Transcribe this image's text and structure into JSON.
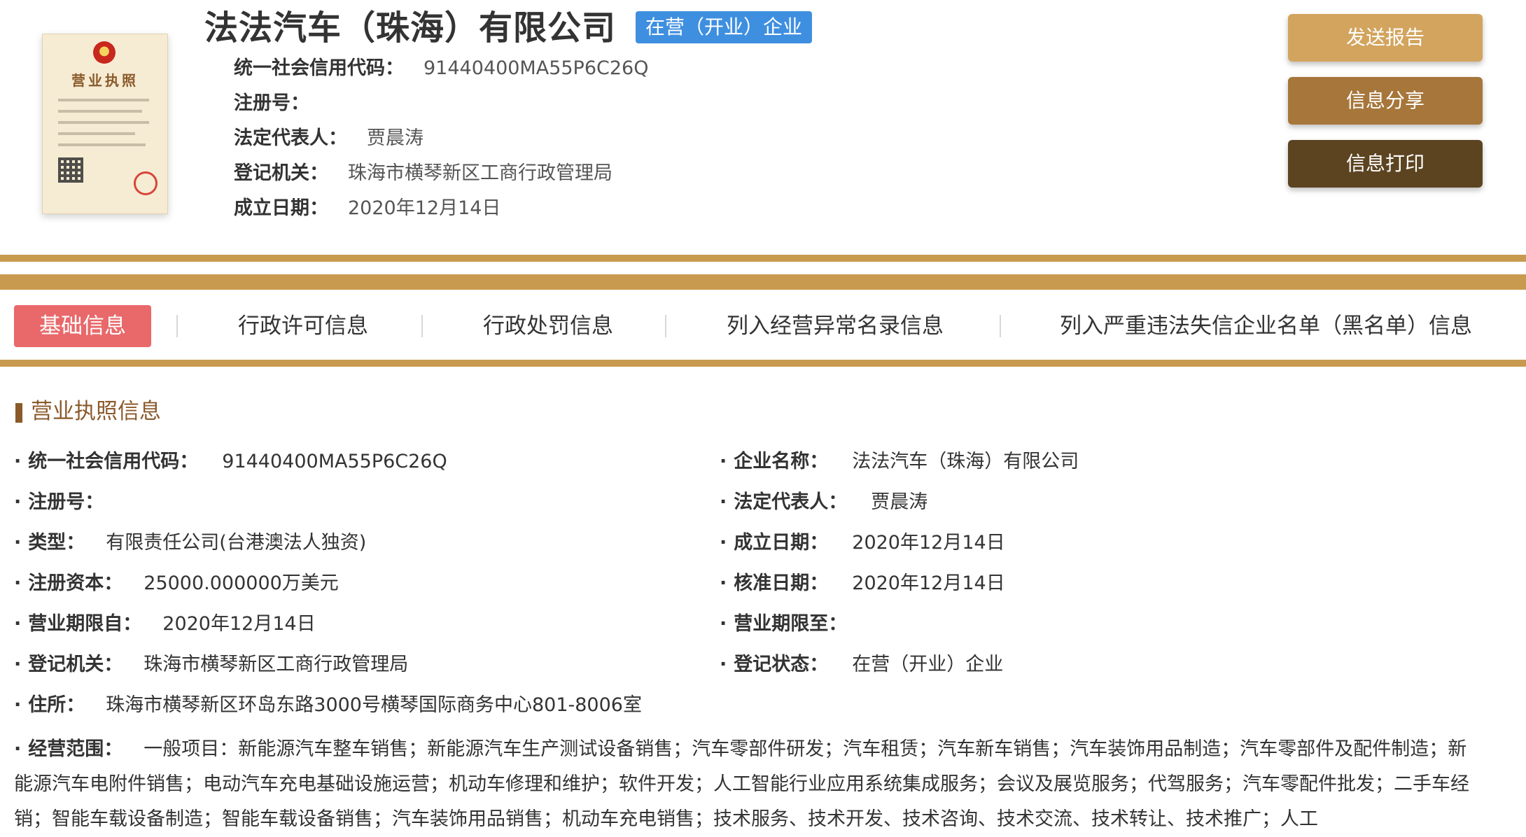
{
  "header": {
    "license_thumbnail": {
      "title": "营业执照"
    },
    "company_name": "法法汽车（珠海）有限公司",
    "status_badge": "在营（开业）企业",
    "info": [
      {
        "label": "统一社会信用代码：",
        "value": "91440400MA55P6C26Q"
      },
      {
        "label": "注册号：",
        "value": ""
      },
      {
        "label": "法定代表人：",
        "value": "贾晨涛"
      },
      {
        "label": "登记机关：",
        "value": "珠海市横琴新区工商行政管理局"
      },
      {
        "label": "成立日期：",
        "value": "2020年12月14日"
      }
    ],
    "buttons": {
      "send_report": "发送报告",
      "share_info": "信息分享",
      "print_info": "信息打印"
    }
  },
  "tabs": [
    {
      "label": "基础信息",
      "active": true
    },
    {
      "label": "行政许可信息",
      "active": false
    },
    {
      "label": "行政处罚信息",
      "active": false
    },
    {
      "label": "列入经营异常名录信息",
      "active": false
    },
    {
      "label": "列入严重违法失信企业名单（黑名单）信息",
      "active": false
    }
  ],
  "section": {
    "title": "营业执照信息",
    "left_fields": [
      {
        "label": "统一社会信用代码：",
        "value": "91440400MA55P6C26Q"
      },
      {
        "label": "注册号：",
        "value": ""
      },
      {
        "label": "类型：",
        "value": "有限责任公司(台港澳法人独资)"
      },
      {
        "label": "注册资本：",
        "value": "25000.000000万美元"
      },
      {
        "label": "营业期限自：",
        "value": "2020年12月14日"
      },
      {
        "label": "登记机关：",
        "value": "珠海市横琴新区工商行政管理局"
      },
      {
        "label": "住所：",
        "value": "珠海市横琴新区环岛东路3000号横琴国际商务中心801-8006室"
      }
    ],
    "right_fields": [
      {
        "label": "企业名称：",
        "value": "法法汽车（珠海）有限公司"
      },
      {
        "label": "法定代表人：",
        "value": "贾晨涛"
      },
      {
        "label": "成立日期：",
        "value": "2020年12月14日"
      },
      {
        "label": "核准日期：",
        "value": "2020年12月14日"
      },
      {
        "label": "营业期限至：",
        "value": ""
      },
      {
        "label": "登记状态：",
        "value": "在营（开业）企业"
      }
    ],
    "scope": {
      "label": "经营范围：",
      "value": "一般项目：新能源汽车整车销售；新能源汽车生产测试设备销售；汽车零部件研发；汽车租赁；汽车新车销售；汽车装饰用品制造；汽车零部件及配件制造；新能源汽车电附件销售；电动汽车充电基础设施运营；机动车修理和维护；软件开发；人工智能行业应用系统集成服务；会议及展览服务；代驾服务；汽车零配件批发；二手车经销；智能车载设备制造；智能车载设备销售；汽车装饰用品销售；机动车充电销售；技术服务、技术开发、技术咨询、技术交流、技术转让、技术推广；人工"
    }
  },
  "colors": {
    "gold_band": "#c89a4f",
    "active_tab": "#e9686a",
    "status_badge": "#3f8fe0",
    "btn_send": "#d3a45e",
    "btn_share": "#a6763a",
    "btn_print": "#5c4421",
    "section_title": "#8a5a2b"
  }
}
